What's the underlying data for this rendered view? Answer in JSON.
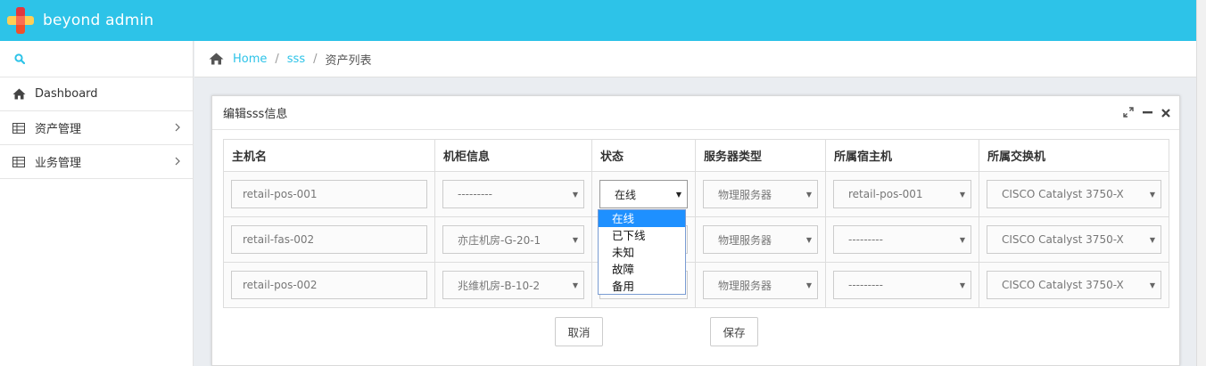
{
  "app": {
    "brand": "beyond admin",
    "accent": "#2dc3e8"
  },
  "sidebar": {
    "search_icon": "search-icon",
    "items": [
      {
        "label": "Dashboard",
        "icon": "home-icon"
      },
      {
        "label": "资产管理",
        "icon": "table-icon"
      },
      {
        "label": "业务管理",
        "icon": "table-icon"
      }
    ]
  },
  "breadcrumb": {
    "home": "Home",
    "second": "sss",
    "current": "资产列表"
  },
  "widget": {
    "title": "编辑sss信息"
  },
  "table": {
    "headers": [
      "主机名",
      "机柜信息",
      "状态",
      "服务器类型",
      "所属宿主机",
      "所属交换机"
    ],
    "rows": [
      {
        "hostname": "retail-pos-001",
        "cabinet": "---------",
        "status": "在线",
        "server_type": "物理服务器",
        "host": "retail-pos-001",
        "switch": "CISCO Catalyst 3750-X"
      },
      {
        "hostname": "retail-fas-002",
        "cabinet": "亦庄机房-G-20-1",
        "status": "",
        "server_type": "物理服务器",
        "host": "---------",
        "switch": "CISCO Catalyst 3750-X"
      },
      {
        "hostname": "retail-pos-002",
        "cabinet": "兆维机房-B-10-2",
        "status": "",
        "server_type": "物理服务器",
        "host": "---------",
        "switch": "CISCO Catalyst 3750-X"
      }
    ]
  },
  "status_dropdown": {
    "options": [
      "在线",
      "已下线",
      "未知",
      "故障",
      "备用"
    ],
    "selected": "在线"
  },
  "buttons": {
    "cancel": "取消",
    "save": "保存"
  }
}
